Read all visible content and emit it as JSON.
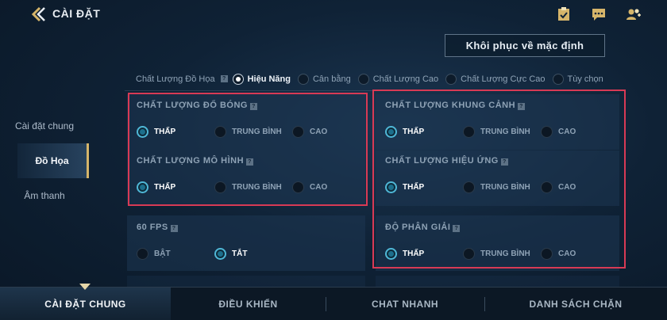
{
  "header": {
    "title": "CÀI ĐẶT"
  },
  "icons": {
    "back": "chevron-left-icon",
    "tasks": "clipboard-check-icon",
    "chat": "chat-icon",
    "friends": "friends-icon"
  },
  "reset_button": "Khôi phục về mặc định",
  "preset": {
    "label": "Chất Lượng Đồ Họa",
    "help": "?",
    "options": [
      "Hiệu Năng",
      "Cân bằng",
      "Chất Lượng Cao",
      "Chất Lượng Cực Cao",
      "Tùy chọn"
    ],
    "selected": "Hiệu Năng"
  },
  "sidebar": {
    "items": [
      "Cài đặt chung",
      "Đồ Họa",
      "Âm thanh"
    ],
    "active": "Đồ Họa"
  },
  "sections": {
    "shadow": {
      "title": "CHẤT LƯỢNG ĐỔ BÓNG",
      "options": [
        "THẤP",
        "TRUNG BÌNH",
        "CAO"
      ],
      "selected": "THẤP"
    },
    "model": {
      "title": "CHẤT LƯỢNG MÔ HÌNH",
      "options": [
        "THẤP",
        "TRUNG BÌNH",
        "CAO"
      ],
      "selected": "THẤP"
    },
    "fps": {
      "title": "60 FPS",
      "options": [
        "BẬT",
        "TẮT"
      ],
      "selected": "TẮT"
    },
    "scene": {
      "title": "CHẤT LƯỢNG KHUNG CẢNH",
      "options": [
        "THẤP",
        "TRUNG BÌNH",
        "CAO"
      ],
      "selected": "THẤP"
    },
    "effects": {
      "title": "CHẤT LƯỢNG HIỆU ỨNG",
      "options": [
        "THẤP",
        "TRUNG BÌNH",
        "CAO"
      ],
      "selected": "THẤP"
    },
    "resolution": {
      "title": "ĐỘ PHÂN GIẢI",
      "options": [
        "THẤP",
        "TRUNG BÌNH",
        "CAO"
      ],
      "selected": "THẤP"
    }
  },
  "bottom_tabs": {
    "items": [
      "CÀI ĐẶT CHUNG",
      "ĐIỀU KHIỂN",
      "CHAT NHANH",
      "DANH SÁCH CHẶN"
    ],
    "active": "CÀI ĐẶT CHUNG"
  },
  "colors": {
    "accent": "#4fb7d6",
    "highlight": "#d83a55",
    "gold": "#d6b56a"
  }
}
